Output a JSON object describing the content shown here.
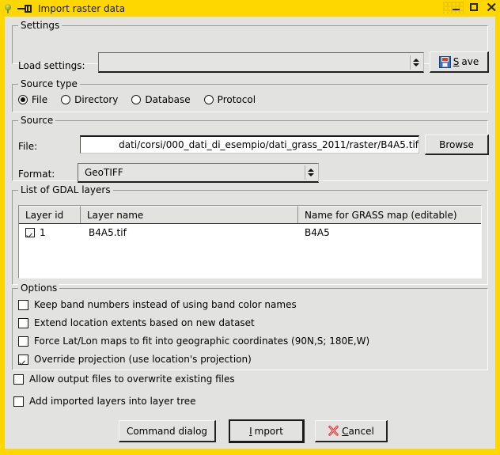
{
  "window": {
    "title": "Import raster data",
    "app_icon": "grass-leaf-icon",
    "pin_icon": "pin-icon",
    "controls": {
      "minimize": "minimize-icon",
      "maximize": "maximize-icon",
      "close": "close-icon"
    },
    "colors": {
      "titlebar": "#ffd700",
      "client_bg": "#e2e2e0",
      "field_bg": "#ffffff",
      "accent_red": "#dd3b2e",
      "accent_blue": "#3a6fc4"
    }
  },
  "settings": {
    "group_title": "Settings",
    "load_label": "Load settings:",
    "load_value": "",
    "save_label": "Save",
    "save_accesskey": "S",
    "save_icon": "floppy-disk-icon",
    "spinner_icon": "spinner-up-down-icon"
  },
  "source_type": {
    "group_title": "Source type",
    "options": [
      {
        "label": "File",
        "selected": true
      },
      {
        "label": "Directory",
        "selected": false
      },
      {
        "label": "Database",
        "selected": false
      },
      {
        "label": "Protocol",
        "selected": false
      }
    ]
  },
  "source": {
    "group_title": "Source",
    "file_label": "File:",
    "file_value": "dati/corsi/000_dati_di_esempio/dati_grass_2011/raster/B4A5.tif",
    "browse_label": "Browse",
    "format_label": "Format:",
    "format_value": "GeoTIFF"
  },
  "layers": {
    "group_title": "List of GDAL layers",
    "columns": [
      "Layer id",
      "Layer name",
      "Name for GRASS map (editable)"
    ],
    "rows": [
      {
        "checked": true,
        "layer_id": "1",
        "layer_name": "B4A5.tif",
        "grass_name": "B4A5"
      }
    ]
  },
  "options": {
    "group_title": "Options",
    "items": [
      {
        "label": "Keep band numbers instead of using band color names",
        "checked": false
      },
      {
        "label": "Extend location extents based on new dataset",
        "checked": false
      },
      {
        "label": "Force Lat/Lon maps to fit into geographic coordinates (90N,S; 180E,W)",
        "checked": false
      },
      {
        "label": "Override projection (use location's projection)",
        "checked": true
      }
    ]
  },
  "extra_options": [
    {
      "label": "Allow output files to overwrite existing files",
      "checked": false
    },
    {
      "label": "Add imported layers into layer tree",
      "checked": false
    }
  ],
  "footer": {
    "command_dialog_label": "Command dialog",
    "import_label": "Import",
    "import_accesskey": "I",
    "cancel_label": "Cancel",
    "cancel_accesskey": "C",
    "cancel_icon": "red-x-icon"
  }
}
